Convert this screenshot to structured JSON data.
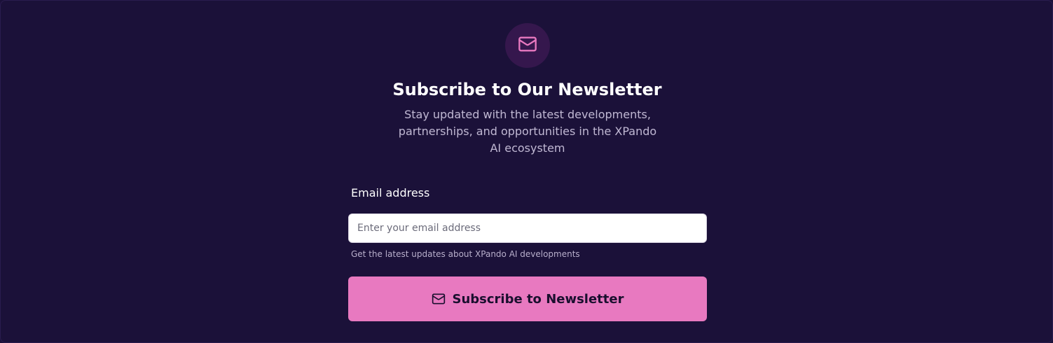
{
  "header": {
    "icon": "mail-icon",
    "title": "Subscribe to Our Newsletter",
    "subtitle": "Stay updated with the latest developments, partnerships, and opportunities in the XPando AI ecosystem"
  },
  "form": {
    "email_label": "Email address",
    "email_placeholder": "Enter your email address",
    "email_value": "",
    "helper_text": "Get the latest updates about XPando AI developments",
    "submit_label": "Subscribe to Newsletter",
    "submit_icon": "mail-icon"
  },
  "colors": {
    "background": "#1b1139",
    "accent": "#e879c0",
    "icon_circle": "#35174d",
    "title_text": "#ffffff",
    "muted_text": "#c0b8d3"
  }
}
